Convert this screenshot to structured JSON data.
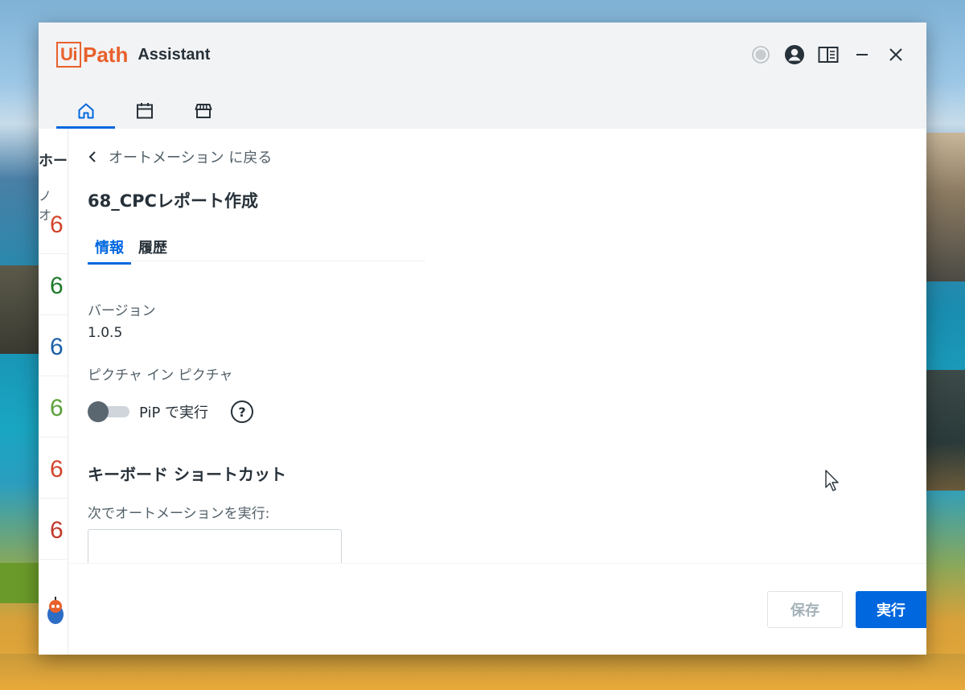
{
  "app": {
    "logo_ui": "Ui",
    "logo_path": "Path",
    "name": "Assistant"
  },
  "title_controls": [
    "status-dot",
    "account",
    "panel-toggle",
    "minimize",
    "close"
  ],
  "nav_tabs": [
    {
      "icon": "home-icon",
      "active": true
    },
    {
      "icon": "calendar-icon",
      "active": false
    },
    {
      "icon": "store-icon",
      "active": false
    }
  ],
  "left_strip": {
    "heading": "ホー",
    "subheading": "ノ オ",
    "numbers": [
      {
        "text": "6",
        "color": "#d2442c"
      },
      {
        "text": "6",
        "color": "#1e7a2a"
      },
      {
        "text": "6",
        "color": "#1a5fa8"
      },
      {
        "text": "6",
        "color": "#5aa03a"
      },
      {
        "text": "6",
        "color": "#d2442c"
      },
      {
        "text": "6",
        "color": "#c0392b"
      }
    ]
  },
  "panel": {
    "back_label": "オートメーション に戻る",
    "title": "68_CPCレポート作成",
    "tabs": [
      {
        "label": "情報",
        "active": true
      },
      {
        "label": "履歴",
        "active": false
      }
    ],
    "version_label": "バージョン",
    "version_value": "1.0.5",
    "pip_label": "ピクチャ イン ピクチャ",
    "pip_toggle_label": "PiP で実行",
    "pip_enabled": false,
    "help_glyph": "?",
    "shortcut_section": "キーボード ショートカット",
    "shortcut_label": "次でオートメーションを実行:",
    "shortcut_value": ""
  },
  "footer": {
    "save_label": "保存",
    "run_label": "実行"
  },
  "colors": {
    "accent": "#0067df",
    "brand": "#e8612c",
    "text": "#273139",
    "muted": "#526069"
  }
}
